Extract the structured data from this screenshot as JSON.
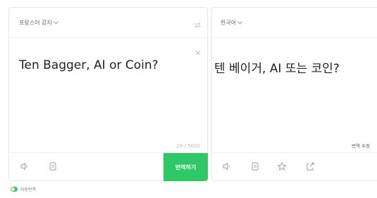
{
  "source": {
    "language_label": "프랑스어 감지",
    "text": "Ten Bagger, AI  or Coin?",
    "counter": "24 / 5000",
    "translate_button": "번역하기"
  },
  "target": {
    "language_label": "한국어",
    "text": "텐 베이거, AI 또는 코인?",
    "edit_label": "번역 수정"
  },
  "footer": {
    "auto_translate_label": "자동번역"
  },
  "colors": {
    "accent": "#2ec866",
    "border": "#e6e6e6"
  },
  "icons": {
    "source_toolbar": [
      "speaker-icon",
      "copy-icon"
    ],
    "target_toolbar": [
      "speaker-icon",
      "copy-icon",
      "star-icon",
      "share-icon"
    ]
  }
}
